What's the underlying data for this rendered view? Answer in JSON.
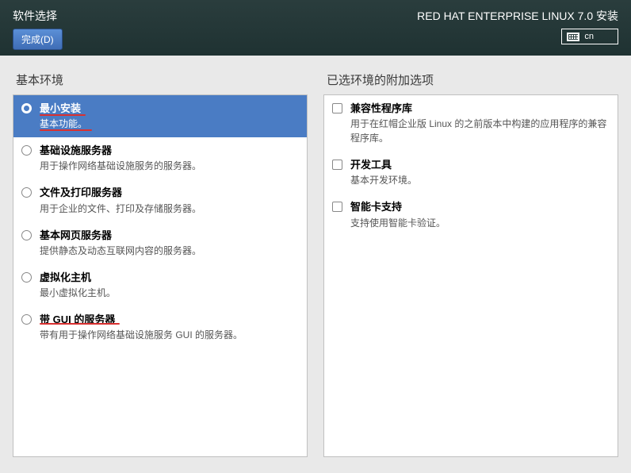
{
  "header": {
    "page_title": "软件选择",
    "done_label": "完成(D)",
    "installer_title": "RED HAT ENTERPRISE LINUX 7.0 安装",
    "keyboard_layout": "cn"
  },
  "left": {
    "title": "基本环境",
    "items": [
      {
        "label": "最小安装",
        "desc": "基本功能。",
        "selected": true,
        "annot_label": true,
        "annot_desc": true
      },
      {
        "label": "基础设施服务器",
        "desc": "用于操作网络基础设施服务的服务器。",
        "selected": false
      },
      {
        "label": "文件及打印服务器",
        "desc": "用于企业的文件、打印及存储服务器。",
        "selected": false
      },
      {
        "label": "基本网页服务器",
        "desc": "提供静态及动态互联网内容的服务器。",
        "selected": false
      },
      {
        "label": "虚拟化主机",
        "desc": "最小虚拟化主机。",
        "selected": false
      },
      {
        "label": "带 GUI 的服务器",
        "desc": "带有用于操作网络基础设施服务 GUI 的服务器。",
        "selected": false,
        "annot_label": true
      }
    ]
  },
  "right": {
    "title": "已选环境的附加选项",
    "items": [
      {
        "label": "兼容性程序库",
        "desc": "用于在红帽企业版 Linux 的之前版本中构建的应用程序的兼容程序库。"
      },
      {
        "label": "开发工具",
        "desc": "基本开发环境。"
      },
      {
        "label": "智能卡支持",
        "desc": "支持使用智能卡验证。"
      }
    ]
  }
}
